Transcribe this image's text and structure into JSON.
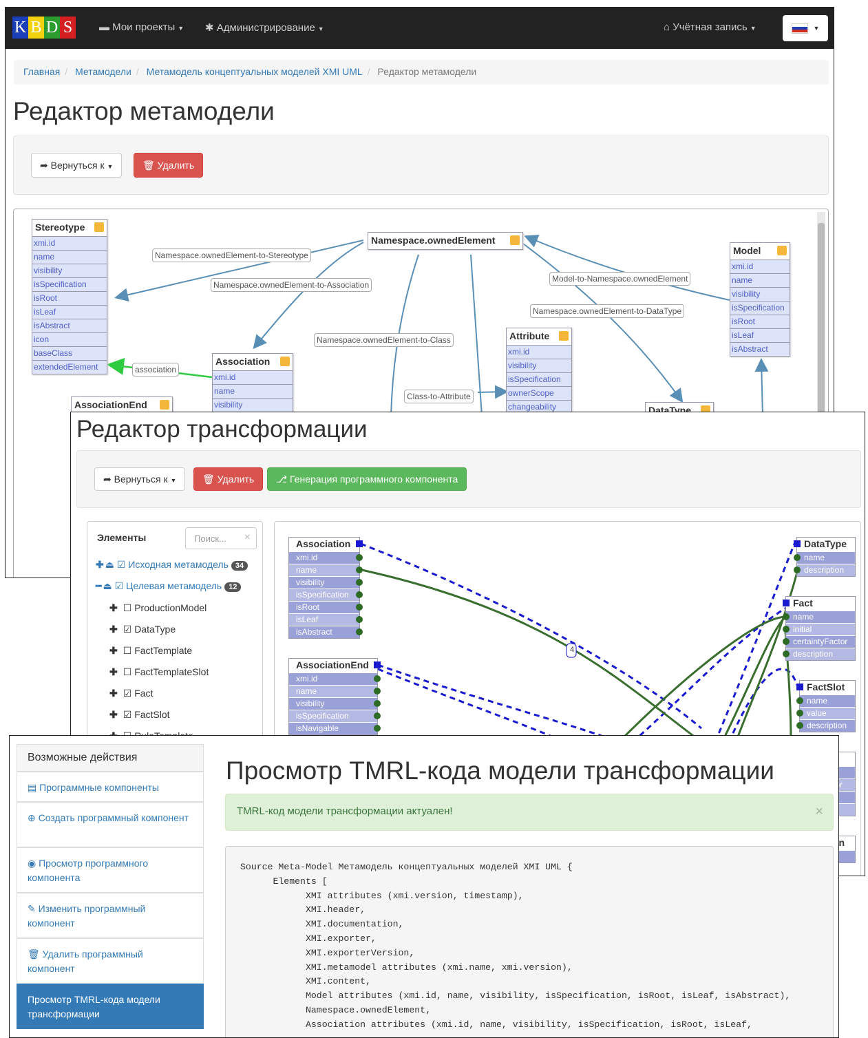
{
  "window1": {
    "logo_letters": [
      {
        "ch": "K",
        "bg": "#1a3fb8"
      },
      {
        "ch": "B",
        "bg": "#f2d20f"
      },
      {
        "ch": "D",
        "bg": "#2e9b2e"
      },
      {
        "ch": "S",
        "bg": "#d42020"
      }
    ],
    "nav": {
      "projects": "Мои проекты",
      "admin": "Администрирование",
      "account": "Учётная запись"
    },
    "breadcrumb": [
      "Главная",
      "Метамодели",
      "Метамодель концептуальных моделей XMI UML",
      "Редактор метамодели"
    ],
    "title": "Редактор метамодели",
    "back_label": "Вернуться к",
    "delete_label": "Удалить",
    "classes": {
      "stereotype": {
        "name": "Stereotype",
        "attrs": [
          "xmi.id",
          "name",
          "visibility",
          "isSpecification",
          "isRoot",
          "isLeaf",
          "isAbstract",
          "icon",
          "baseClass",
          "extendedElement"
        ]
      },
      "namespace": {
        "name": "Namespace.ownedElement",
        "attrs": []
      },
      "model": {
        "name": "Model",
        "attrs": [
          "xmi.id",
          "name",
          "visibility",
          "isSpecification",
          "isRoot",
          "isLeaf",
          "isAbstract"
        ]
      },
      "association": {
        "name": "Association",
        "attrs": [
          "xmi.id",
          "name",
          "visibility"
        ]
      },
      "attribute": {
        "name": "Attribute",
        "attrs": [
          "xmi.id",
          "visibility",
          "isSpecification",
          "ownerScope",
          "changeability"
        ]
      },
      "association_end": {
        "name": "AssociationEnd",
        "attrs": []
      },
      "data_type": {
        "name": "DataType",
        "attrs": []
      }
    },
    "links": {
      "to_stereotype": "Namespace.ownedElement-to-Stereotype",
      "to_association": "Namespace.ownedElement-to-Association",
      "to_class": "Namespace.ownedElement-to-Class",
      "to_datatype": "Namespace.ownedElement-to-DataType",
      "model_to_ns": "Model-to-Namespace.ownedElement",
      "class_to_attr": "Class-to-Attribute",
      "association": "association"
    }
  },
  "window2": {
    "title": "Редактор трансформации",
    "back_label": "Вернуться к",
    "delete_label": "Удалить",
    "generate_label": "Генерация программного компонента",
    "elements_title": "Элементы",
    "search_placeholder": "Поиск...",
    "source_label": "Исходная метамодель",
    "source_count": "34",
    "target_label": "Целевая метамодель",
    "target_count": "12",
    "tree": [
      {
        "label": "ProductionModel",
        "checked": false
      },
      {
        "label": "DataType",
        "checked": true
      },
      {
        "label": "FactTemplate",
        "checked": false
      },
      {
        "label": "FactTemplateSlot",
        "checked": false
      },
      {
        "label": "Fact",
        "checked": true
      },
      {
        "label": "FactSlot",
        "checked": true
      },
      {
        "label": "RuleTemplate",
        "checked": false
      }
    ],
    "left_classes": {
      "association": {
        "name": "Association",
        "attrs": [
          "xmi.id",
          "name",
          "visibility",
          "isSpecification",
          "isRoot",
          "isLeaf",
          "isAbstract"
        ]
      },
      "association_end": {
        "name": "AssociationEnd",
        "attrs": [
          "xmi.id",
          "name",
          "visibility",
          "isSpecification",
          "isNavigable"
        ]
      }
    },
    "right_classes": {
      "data_type": {
        "name": "DataType",
        "attrs": [
          "name",
          "description"
        ]
      },
      "fact": {
        "name": "Fact",
        "attrs": [
          "name",
          "initial",
          "certaintyFactor",
          "description"
        ]
      },
      "fact_slot": {
        "name": "FactSlot",
        "attrs": [
          "name",
          "value",
          "description"
        ]
      },
      "partial1": {
        "name": "",
        "attrs": [
          "",
          "tor",
          "",
          ""
        ]
      },
      "partial2": {
        "name": "on",
        "attrs": [
          ""
        ]
      }
    },
    "link_badge": "4"
  },
  "window3": {
    "sidebar_title": "Возможные действия",
    "actions": [
      {
        "icon": "list-icon",
        "label": "Программные компоненты"
      },
      {
        "icon": "plus-circle-icon",
        "label": "Создать программный компонент"
      },
      {
        "icon": "eye-icon",
        "label": "Просмотр программного компонента"
      },
      {
        "icon": "pencil-icon",
        "label": "Изменить программный компонент"
      },
      {
        "icon": "trash-icon",
        "label": "Удалить программный компонент"
      },
      {
        "icon": "",
        "label": "Просмотр TMRL-кода модели трансформации"
      }
    ],
    "title": "Просмотр TMRL-кода модели трансформации",
    "alert": "TMRL-код модели трансформации актуален!",
    "code": "Source Meta-Model Метамодель концептуальных моделей XMI UML {\n      Elements [\n            XMI attributes (xmi.version, timestamp),\n            XMI.header,\n            XMI.documentation,\n            XMI.exporter,\n            XMI.exporterVersion,\n            XMI.metamodel attributes (xmi.name, xmi.version),\n            XMI.content,\n            Model attributes (xmi.id, name, visibility, isSpecification, isRoot, isLeaf, isAbstract),\n            Namespace.ownedElement,\n            Association attributes (xmi.id, name, visibility, isSpecification, isRoot, isLeaf,"
  }
}
